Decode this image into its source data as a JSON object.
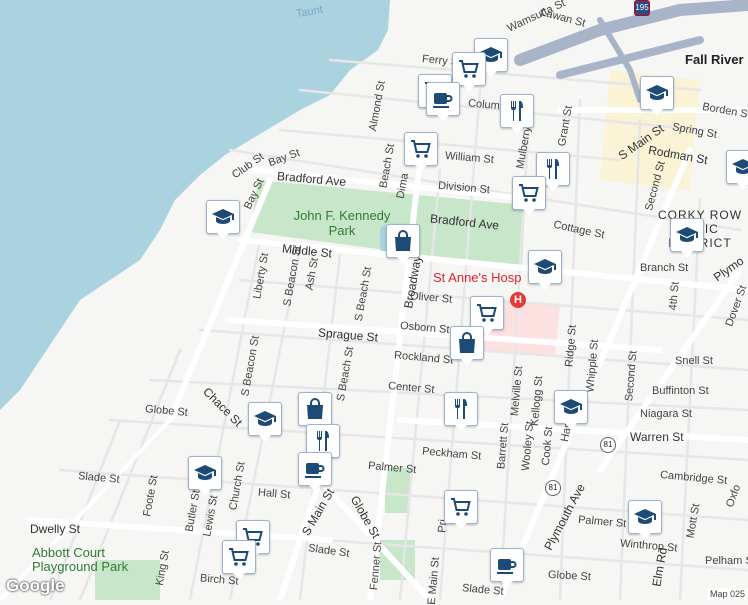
{
  "map": {
    "streets": {
      "bradford_ave_w": "Bradford Ave",
      "bradford_ave_e": "Bradford Ave",
      "middle_st": "Middle St",
      "sprague_st": "Sprague St",
      "broadway": "Broadway",
      "globe_st": "Globe St",
      "globe_st_se": "Globe St",
      "s_main_st": "S Main St",
      "s_main_st_ne": "S Main St",
      "plymouth_ave": "Plymouth Ave",
      "dwelly_st": "Dwelly St",
      "warren_st": "Warren St",
      "chace_st": "Chace St",
      "bay_st": "Bay St",
      "bay_st2": "Bay St",
      "club_st": "Club St",
      "ferry_st": "Ferry St",
      "almond_st": "Almond St",
      "beach_st": "Beach St",
      "william_st": "William St",
      "division_st": "Division St",
      "cottage_st": "Cottage St",
      "liberty_st": "Liberty St",
      "s_beacon_st": "S Beacon St",
      "s_beacon_st2": "S Beacon St",
      "ash_st": "Ash St",
      "s_beach_st": "S Beach St",
      "s_beach_st2": "S Beach St",
      "oliver_st": "Oliver St",
      "osborn_st": "Osborn St",
      "rockland_st": "Rockland St",
      "center_st": "Center St",
      "globe_st_w": "Globe St",
      "peckham_st": "Peckham St",
      "palmer_st": "Palmer St",
      "palmer_st2": "Palmer St",
      "slade_st": "Slade St",
      "slade_st2": "Slade St",
      "slade_st3": "Slade St",
      "hall_st": "Hall St",
      "foote_st": "Foote St",
      "butler_st": "Butler St",
      "lewis_st": "Lewis St",
      "church_st": "Church St",
      "king_st": "King St",
      "birch_st": "Birch St",
      "fenner_st": "Fenner St",
      "e_main_st": "E Main St",
      "melville_st": "Melville St",
      "barrett_st": "Barrett St",
      "wooley_st": "Wooley St",
      "kellogg_st": "Kellogg St",
      "cook_st": "Cook St",
      "ridge_st": "Ridge St",
      "whipple_st": "Whipple St",
      "second_st": "Second St",
      "second_st2": "Second St",
      "fourth_st": "4th St",
      "branch_st": "Branch St",
      "snell_st": "Snell St",
      "buffinton_st": "Buffinton St",
      "niagara_st": "Niagara St",
      "cambridge_st": "Cambridge St",
      "winthrop_st": "Winthrop St",
      "pelham_st": "Pelham S",
      "mott_st": "Mott St",
      "spring_st": "Spring St",
      "rodman_st": "Rodman St",
      "borden_st": "Borden St",
      "mulberry_st": "Mulberry St",
      "grant_st": "Grant St",
      "columbia_st": "Columbia St",
      "dover_st": "Dover St",
      "oxford_st": "Oxfo",
      "plymo": "Plymo",
      "dima": "Dima",
      "wamsutta": "Wamsutta St",
      "lawan": "Lawan St",
      "hamlet": "Hamlet St",
      "prince": "Pri",
      "elm_rd": "Elm Rd"
    },
    "places": {
      "city": "Fall River",
      "park": "John F. Kennedy Park",
      "district": "CORKY ROW H  RIC DISTRICT",
      "abbott_park": "Abbott Court Playground Park",
      "hospital": "St Anne's Hosp",
      "water": "Taunt"
    },
    "shields": {
      "route_81a": "81",
      "route_81b": "81",
      "route_195": "195"
    },
    "attribution": {
      "logo": "Google",
      "copyright": "Map    025"
    },
    "colors": {
      "water": "#aad3df",
      "park": "#c8e6c9",
      "road": "#ffffff",
      "pin_icon": "#1e4a76",
      "hospital": "#fde0e0"
    }
  },
  "pins": [
    {
      "type": "education",
      "icon": "graduation-cap-icon"
    },
    {
      "type": "shopping",
      "icon": "shopping-cart-icon"
    },
    {
      "type": "shopping",
      "icon": "shopping-cart-icon"
    },
    {
      "type": "coffee",
      "icon": "coffee-cup-icon"
    },
    {
      "type": "restaurant",
      "icon": "fork-knife-icon"
    },
    {
      "type": "shopping",
      "icon": "shopping-cart-icon"
    },
    {
      "type": "education",
      "icon": "graduation-cap-icon"
    },
    {
      "type": "restaurant",
      "icon": "fork-knife-icon"
    },
    {
      "type": "education",
      "icon": "graduation-cap-icon"
    },
    {
      "type": "shopping",
      "icon": "shopping-cart-icon"
    },
    {
      "type": "education",
      "icon": "graduation-cap-icon"
    },
    {
      "type": "shopping",
      "icon": "shopping-bag-icon"
    },
    {
      "type": "education",
      "icon": "graduation-cap-icon"
    },
    {
      "type": "education",
      "icon": "graduation-cap-icon"
    },
    {
      "type": "shopping",
      "icon": "shopping-cart-icon"
    },
    {
      "type": "shopping",
      "icon": "shopping-bag-icon"
    },
    {
      "type": "restaurant",
      "icon": "fork-knife-icon"
    },
    {
      "type": "education",
      "icon": "graduation-cap-icon"
    },
    {
      "type": "education",
      "icon": "graduation-cap-icon"
    },
    {
      "type": "shopping",
      "icon": "shopping-bag-icon"
    },
    {
      "type": "restaurant",
      "icon": "fork-knife-icon"
    },
    {
      "type": "coffee",
      "icon": "coffee-cup-icon"
    },
    {
      "type": "education",
      "icon": "graduation-cap-icon"
    },
    {
      "type": "shopping",
      "icon": "shopping-cart-icon"
    },
    {
      "type": "shopping",
      "icon": "shopping-cart-icon"
    },
    {
      "type": "education",
      "icon": "graduation-cap-icon"
    },
    {
      "type": "coffee",
      "icon": "coffee-cup-icon"
    },
    {
      "type": "shopping",
      "icon": "shopping-cart-icon"
    }
  ]
}
